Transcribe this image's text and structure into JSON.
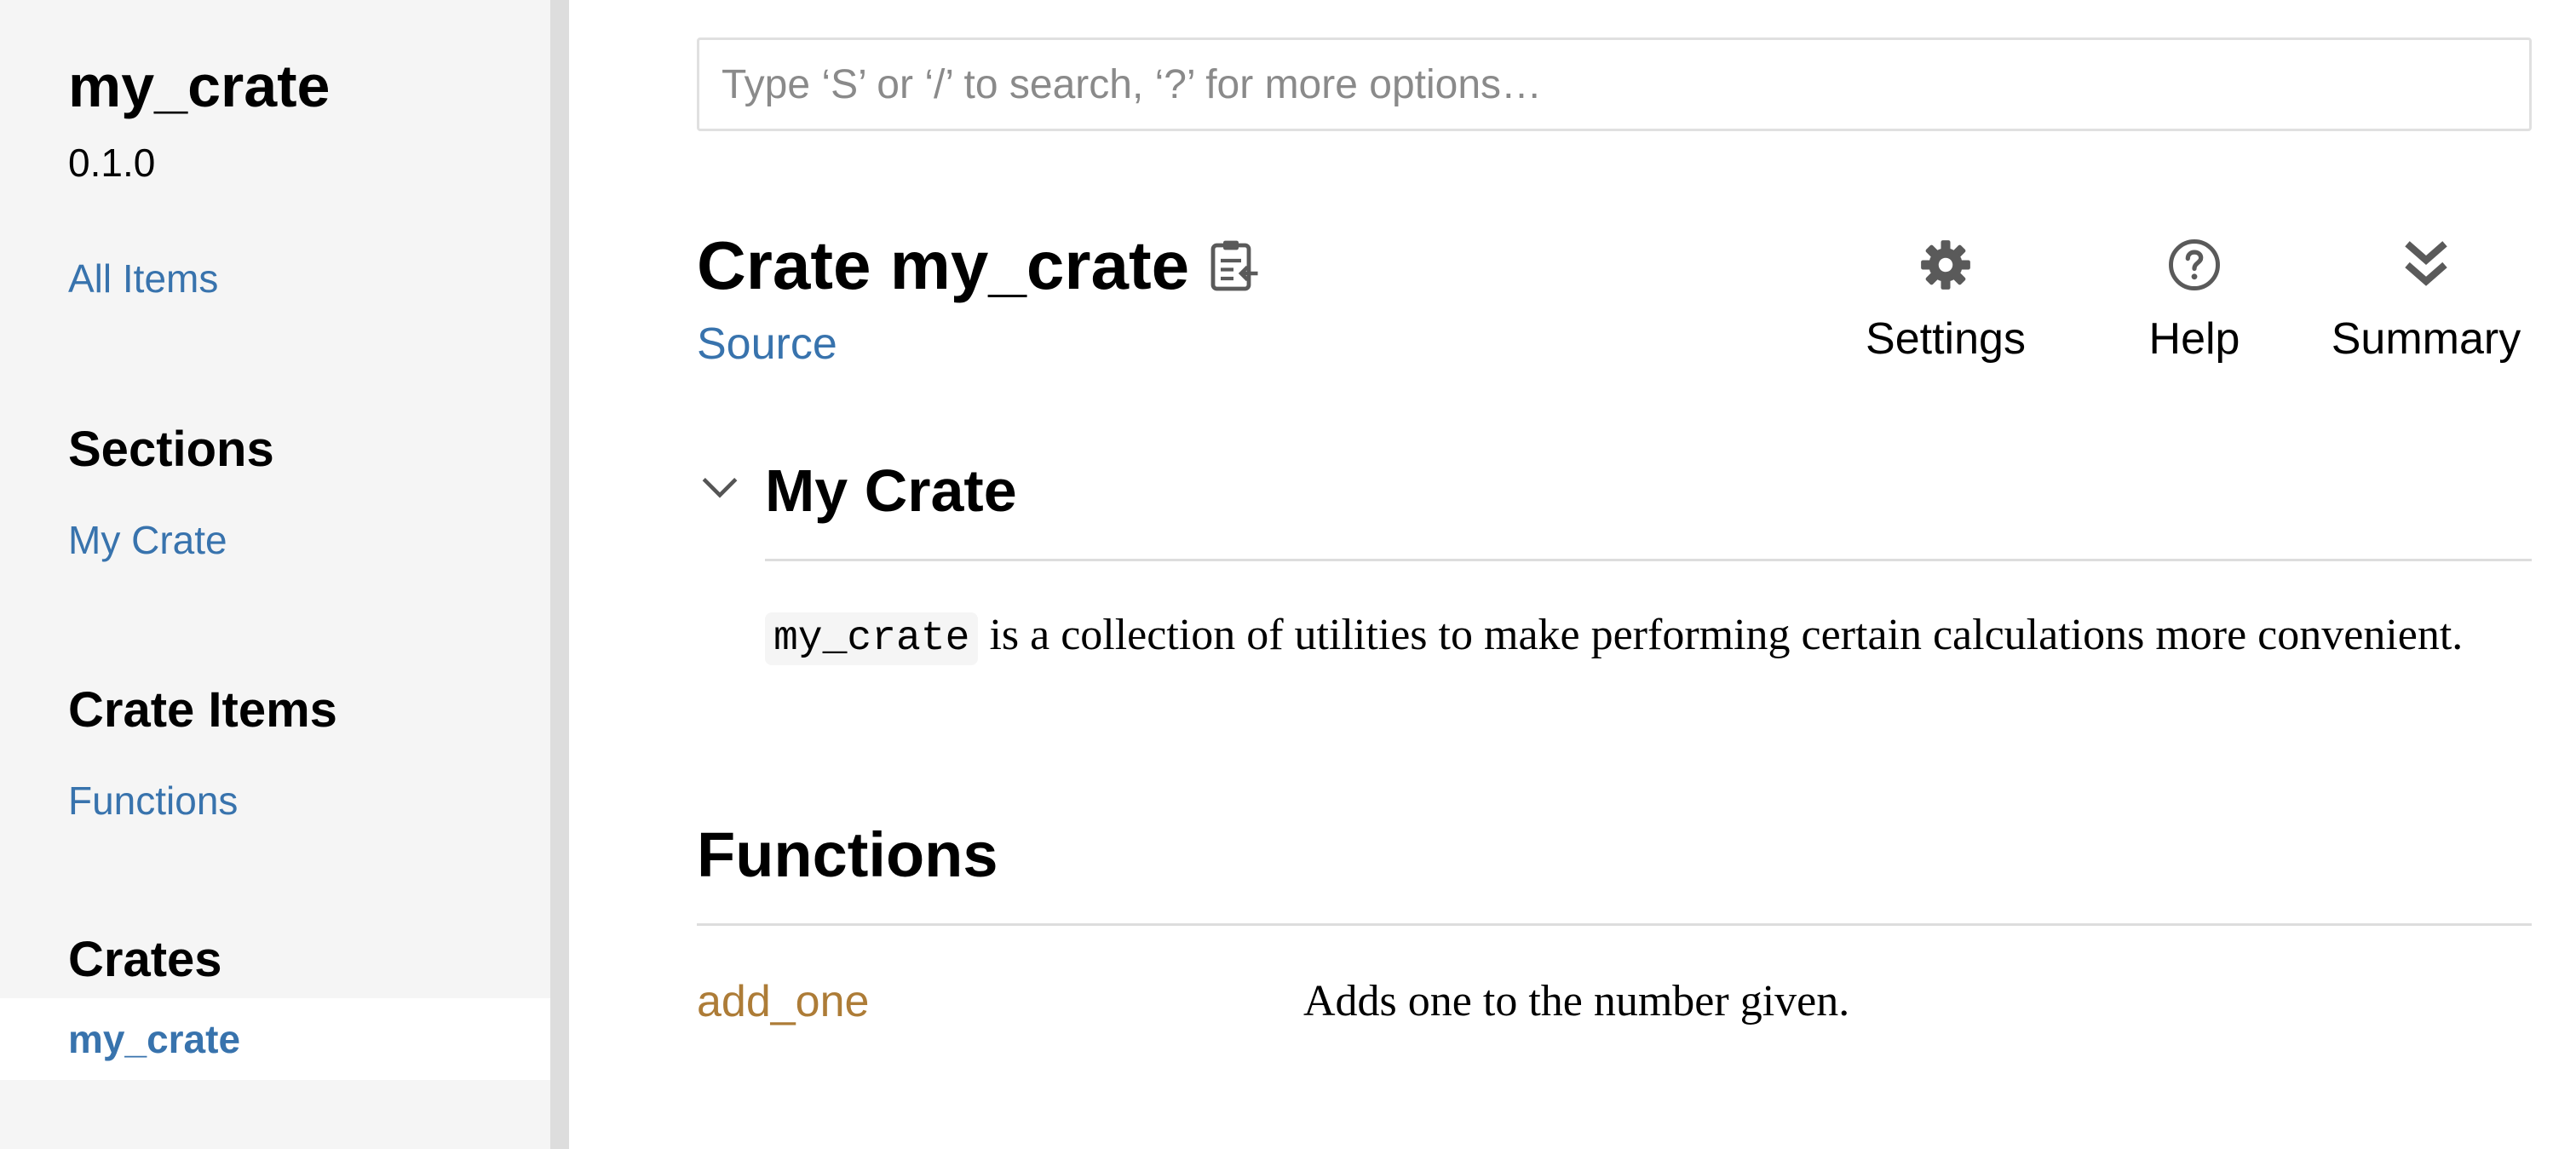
{
  "sidebar": {
    "crate_name": "my_crate",
    "version": "0.1.0",
    "all_items": "All Items",
    "sections_heading": "Sections",
    "sections": [
      "My Crate"
    ],
    "crate_items_heading": "Crate Items",
    "crate_items": [
      "Functions"
    ],
    "crates_heading": "Crates",
    "crates": [
      "my_crate"
    ]
  },
  "search": {
    "placeholder": "Type ‘S’ or ‘/’ to search, ‘?’ for more options…",
    "value": ""
  },
  "header": {
    "title": "Crate my_crate",
    "source_link": "Source",
    "copy_icon": "clipboard-icon",
    "buttons": [
      {
        "label": "Settings",
        "icon": "gear-icon"
      },
      {
        "label": "Help",
        "icon": "help-circle-icon"
      },
      {
        "label": "Summary",
        "icon": "double-chevron-down-icon"
      }
    ]
  },
  "docs": {
    "section_heading": "My Crate",
    "toggle_icon": "chevron-down-icon",
    "code_term": "my_crate",
    "description": " is a collection of utilities to make performing certain calculations more convenient."
  },
  "functions": {
    "heading": "Functions",
    "items": [
      {
        "name": "add_one",
        "description": "Adds one to the number given."
      }
    ]
  },
  "colors": {
    "link": "#3873ad",
    "function": "#ad7c37",
    "sidebar_bg": "#f5f5f5",
    "icon": "#5a5a5a"
  }
}
